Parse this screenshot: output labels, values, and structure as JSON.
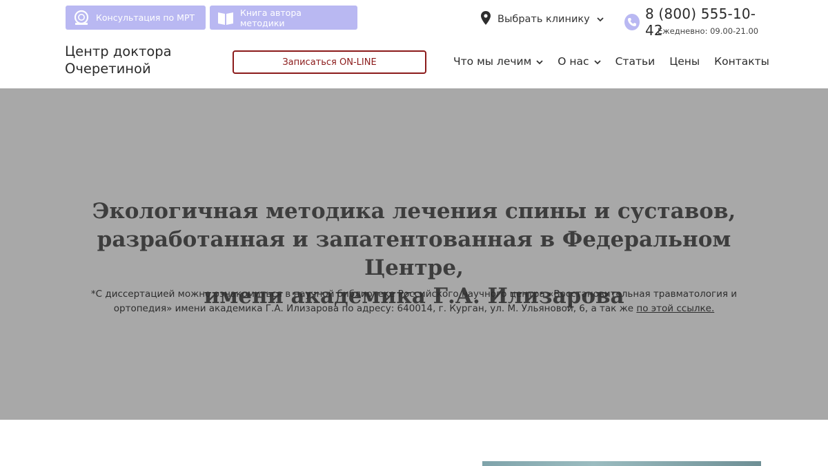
{
  "header": {
    "top_buttons": [
      {
        "label": "Консультация по МРТ",
        "icon": "mri-scanner-icon"
      },
      {
        "label": "Книга автора методики",
        "icon": "open-book-icon"
      }
    ],
    "clinic_select": {
      "label": "Выбрать клинику",
      "icon": "location-pin-icon"
    },
    "phone": {
      "number": "8 (800) 555-10-42",
      "hours": "Ежедневно: 09.00-21.00",
      "icon": "phone-icon"
    },
    "logo": {
      "line1": "Центр доктора",
      "line2": "Очеретиной"
    },
    "cta_label": "Записаться ON-LINE",
    "nav": [
      {
        "label": "Что мы лечим",
        "dropdown": true
      },
      {
        "label": "О нас",
        "dropdown": true
      },
      {
        "label": "Статьи",
        "dropdown": false
      },
      {
        "label": "Цены",
        "dropdown": false
      },
      {
        "label": "Контакты",
        "dropdown": false
      }
    ]
  },
  "hero": {
    "title_line1": "Экологичная методика лечения спины и суставов,",
    "title_line2": "разработанная и запатентованная в Федеральном Центре,",
    "title_line3": "имени академика Г.А. Илизарова",
    "note_text": "*С диссертацией можно ознакомиться в научной библиотеке Российского научного центра «Восстановительная травматология и ортопедия» имени академика Г.А. Илизарова по адресу: 640014, г. Курган, ул. М. Ульяновой, 6, а так же",
    "note_link": "по этой ссылке."
  },
  "colors": {
    "accent_lavender": "#b9b8f2",
    "cta_red": "#8b1a1a",
    "hero_gray": "#a8a8a8"
  }
}
